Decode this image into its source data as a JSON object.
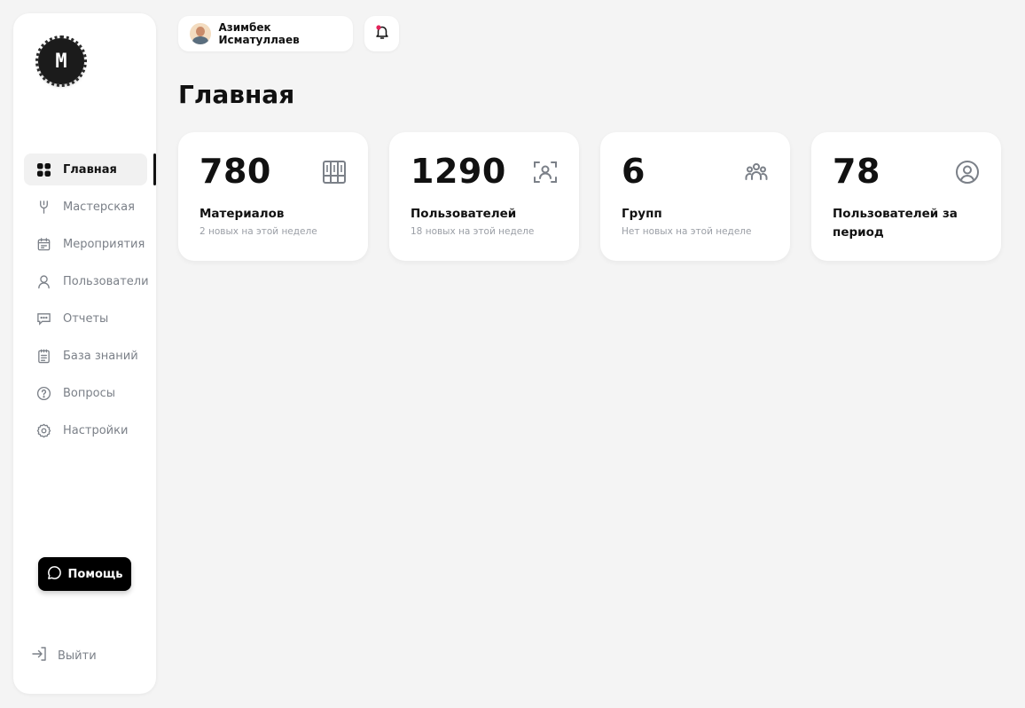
{
  "sidebar": {
    "items": [
      {
        "label": "Главная",
        "icon": "dashboard-icon",
        "active": true
      },
      {
        "label": "Мастерская",
        "icon": "tool-icon"
      },
      {
        "label": "Мероприятия",
        "icon": "calendar-icon"
      },
      {
        "label": "Пользователи",
        "icon": "user-icon"
      },
      {
        "label": "Отчеты",
        "icon": "chat-icon"
      },
      {
        "label": "База знаний",
        "icon": "clipboard-icon"
      },
      {
        "label": "Вопросы",
        "icon": "question-icon"
      },
      {
        "label": "Настройки",
        "icon": "gear-icon"
      }
    ],
    "help_label": "Помощь",
    "logout_label": "Выйти"
  },
  "header": {
    "user_name": "Азимбек Исматуллаев"
  },
  "main": {
    "title": "Главная",
    "cards": [
      {
        "value": "780",
        "label": "Материалов",
        "sub": "2 новых на этой неделе",
        "icon": "columns-icon"
      },
      {
        "value": "1290",
        "label": "Пользователей",
        "sub": "18 новых на этой неделе",
        "icon": "user-scan-icon"
      },
      {
        "value": "6",
        "label": "Групп",
        "sub": "Нет новых на этой неделе",
        "icon": "group-icon"
      },
      {
        "value": "78",
        "label": "Пользователей за период",
        "sub": "",
        "icon": "user-circle-icon"
      }
    ]
  },
  "colors": {
    "accent": "#111111",
    "muted": "#7b8088",
    "background": "#f4f4f4",
    "notification": "#e2245a"
  }
}
